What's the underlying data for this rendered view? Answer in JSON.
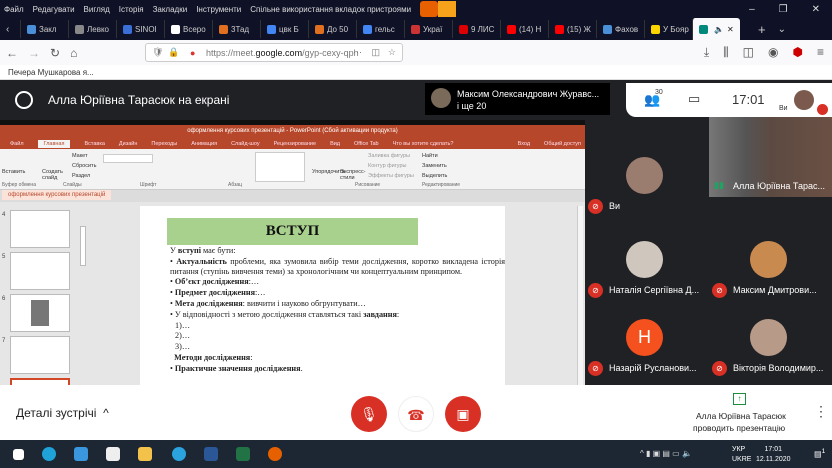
{
  "browser": {
    "menu": [
      "Файл",
      "Редагувати",
      "Вигляд",
      "Історія",
      "Закладки",
      "Інструменти",
      "Спільне використання вкладок пристроями"
    ],
    "tabs": [
      {
        "label": "Закл",
        "color": "#4a90d9"
      },
      {
        "label": "Левко",
        "color": "#888"
      },
      {
        "label": "SINOI",
        "color": "#3a6fd8"
      },
      {
        "label": "Всеро",
        "color": "#fff"
      },
      {
        "label": "3Тад",
        "color": "#e07020"
      },
      {
        "label": "цвк Б",
        "color": "#4285f4"
      },
      {
        "label": "До 50",
        "color": "#e07020"
      },
      {
        "label": "гельс",
        "color": "#4285f4"
      },
      {
        "label": "Украї",
        "color": "#c33"
      },
      {
        "label": "9 ЛИС",
        "color": "#d00"
      },
      {
        "label": "(14) Н",
        "color": "#f00"
      },
      {
        "label": "(15) Ж",
        "color": "#f00"
      },
      {
        "label": "Фахов",
        "color": "#4a90d9"
      },
      {
        "label": "У Бояр",
        "color": "#ffd500"
      },
      {
        "label": "",
        "color": "#00897b"
      }
    ],
    "url_prefix": "https://meet.",
    "url_domain": "google.com",
    "url_path": "/gyp-cexy-qph",
    "bookmark": "Печера Мушкарова я..."
  },
  "meet": {
    "presenting_title": "Алла Юріївна Тарасюк на екрані",
    "presenter_name": "Максим Олександрович Журавс...",
    "presenter_more": "і ще 20",
    "participants_count": "30",
    "time": "17:01",
    "self_label": "Ви",
    "tiles": [
      {
        "name": "Ви",
        "muted": true,
        "color": "#9b7d70"
      },
      {
        "name": "Алла Юріївна Тарас...",
        "muted": false,
        "video": true,
        "color": "#5c4a42"
      },
      {
        "name": "Наталія Сергіївна Д...",
        "muted": true,
        "color": "#cfc6bd"
      },
      {
        "name": "Максим Дмитрови...",
        "muted": true,
        "color": "#c98a50"
      },
      {
        "name": "Назарій Русланови...",
        "muted": true,
        "initial": "Н",
        "color": "#f4511e"
      },
      {
        "name": "Вікторія Володимир...",
        "muted": true,
        "color": "#b79a88"
      }
    ],
    "details_label": "Деталі зустрічі",
    "presenting_by": "Алла Юріївна Тарасюк",
    "presenting_status": "проводить презентацію"
  },
  "ppt": {
    "title": "оформлення курсових презентацій - PowerPoint (Сбой активации продукта)",
    "tabs": [
      "Файл",
      "Главная",
      "Вставка",
      "Дизайн",
      "Переходы",
      "Анимация",
      "Слайд-шоу",
      "Рецензирование",
      "Вид",
      "Office Tab",
      "Что вы хотите сделать?"
    ],
    "signin": "Вход",
    "share": "Общий доступ",
    "ribbon": {
      "paste": "Вставить",
      "new_slide": "Создать слайд",
      "layout": "Макет",
      "reset": "Сбросить",
      "section": "Раздел",
      "arrange": "Упорядочить",
      "styles": "Экспресс-стили",
      "fill": "Заливка фигуры",
      "outline": "Контур фигуры",
      "effects": "Эффекты фигуры",
      "find": "Найти",
      "replace": "Заменить",
      "select": "Выделить",
      "groups": [
        "Буфер обмена",
        "Слайды",
        "Шрифт",
        "Абзац",
        "Рисование",
        "Редактирование"
      ]
    },
    "doc_tab": "оформлення курсових презентацій",
    "slide_numbers": [
      "4",
      "5",
      "6",
      "7"
    ],
    "slide": {
      "title": "ВСТУП",
      "intro_a": "У ",
      "intro_b": "вступі",
      "intro_c": " має бути:",
      "b1_bold": "Актуальність",
      "b1": " проблеми, яка зумовила вибір теми дослідження, коротко викладена історія питання (ступінь вивчення теми) за хронологічним чи концептуальним принципом.",
      "b2_bold": "Об’єкт дослідження",
      "b2": ":…",
      "b3_bold": "Предмет дослідження",
      "b3": ":…",
      "b4_bold": "Мета дослідження",
      "b4": ": вивчити і науково обгрунтувати…",
      "b5": "У відповідності з метою дослідження ставляться такі ",
      "b5_bold": "завдання",
      "b5_end": ":",
      "n1": "1)…",
      "n2": "2)…",
      "n3": "3)…",
      "b6_bold": "Методи дослідження",
      "b6": ":",
      "b7_bold": "Практичне значення дослідження",
      "b7": "."
    }
  },
  "taskbar": {
    "lang1": "УКР",
    "lang2": "UKRE",
    "time": "17:01",
    "date": "12.11.2020",
    "notif": "1"
  }
}
